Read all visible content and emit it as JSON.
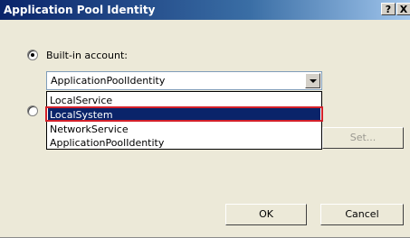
{
  "window": {
    "title": "Application Pool Identity",
    "help_label": "?",
    "close_label": "X"
  },
  "identity": {
    "builtin_label": "Built-in account:",
    "builtin_selected": true,
    "custom_selected": false,
    "combo_value": "ApplicationPoolIdentity",
    "options": [
      "LocalService",
      "LocalSystem",
      "NetworkService",
      "ApplicationPoolIdentity"
    ],
    "highlighted_option": "LocalSystem"
  },
  "buttons": {
    "set_label": "Set...",
    "ok_label": "OK",
    "cancel_label": "Cancel"
  },
  "colors": {
    "title_bar": "#0a246a",
    "selection": "#0a246a",
    "annotation_outline": "#d4202a"
  }
}
